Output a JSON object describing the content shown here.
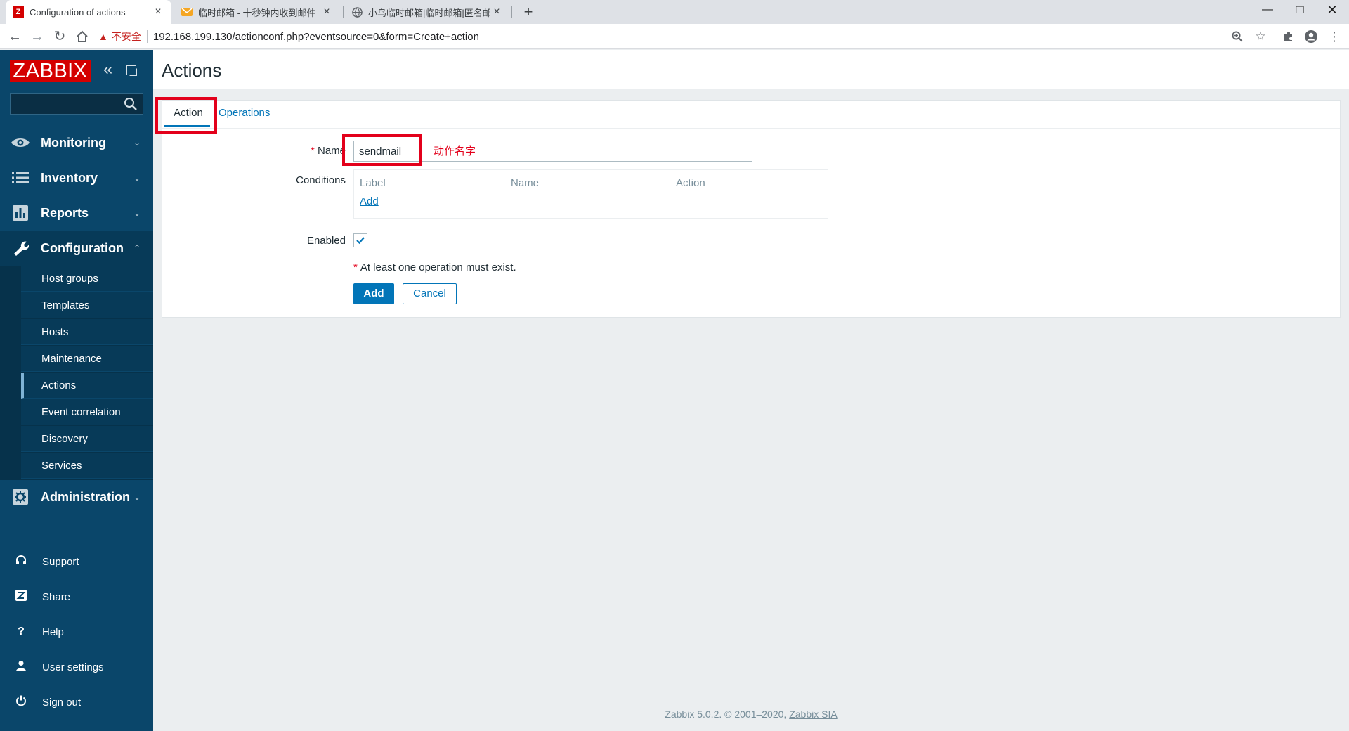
{
  "browser": {
    "tabs": [
      {
        "title": "Configuration of actions",
        "favicon": "zabbix-icon"
      },
      {
        "title": "临时邮箱 - 十秒钟内收到邮件",
        "favicon": "mail-icon"
      },
      {
        "title": "小鸟临时邮箱|临时邮箱|匿名邮箱",
        "favicon": "globe-icon"
      }
    ],
    "insecure_label": "不安全",
    "url": "192.168.199.130/actionconf.php?eventsource=0&form=Create+action"
  },
  "sidebar": {
    "logo": "ZABBIX",
    "main_items": [
      {
        "label": "Monitoring",
        "icon": "eye-icon"
      },
      {
        "label": "Inventory",
        "icon": "list-icon"
      },
      {
        "label": "Reports",
        "icon": "bar-chart-icon"
      },
      {
        "label": "Configuration",
        "icon": "wrench-icon"
      },
      {
        "label": "Administration",
        "icon": "gear-icon"
      }
    ],
    "config_sub": [
      "Host groups",
      "Templates",
      "Hosts",
      "Maintenance",
      "Actions",
      "Event correlation",
      "Discovery",
      "Services"
    ],
    "selected_sub": "Actions",
    "bottom": [
      {
        "label": "Support",
        "icon": "headset-icon"
      },
      {
        "label": "Share",
        "icon": "share-z-icon"
      },
      {
        "label": "Help",
        "icon": "help-icon"
      },
      {
        "label": "User settings",
        "icon": "user-icon"
      },
      {
        "label": "Sign out",
        "icon": "power-icon"
      }
    ]
  },
  "page": {
    "title": "Actions",
    "tabs": {
      "action": "Action",
      "operations": "Operations"
    },
    "form": {
      "name_label": "Name",
      "name_value": "sendmail",
      "name_annotation": "动作名字",
      "conditions_label": "Conditions",
      "conditions_headers": [
        "Label",
        "Name",
        "Action"
      ],
      "conditions_add": "Add",
      "enabled_label": "Enabled",
      "enabled": true,
      "note": "At least one operation must exist.",
      "add_button": "Add",
      "cancel_button": "Cancel"
    }
  },
  "footer": {
    "text": "Zabbix 5.0.2. © 2001–2020,",
    "link": "Zabbix SIA"
  },
  "colors": {
    "sidebar": "#0a466a",
    "accent": "#0275b8",
    "highlight": "#e3001b",
    "logo": "#d40000"
  }
}
